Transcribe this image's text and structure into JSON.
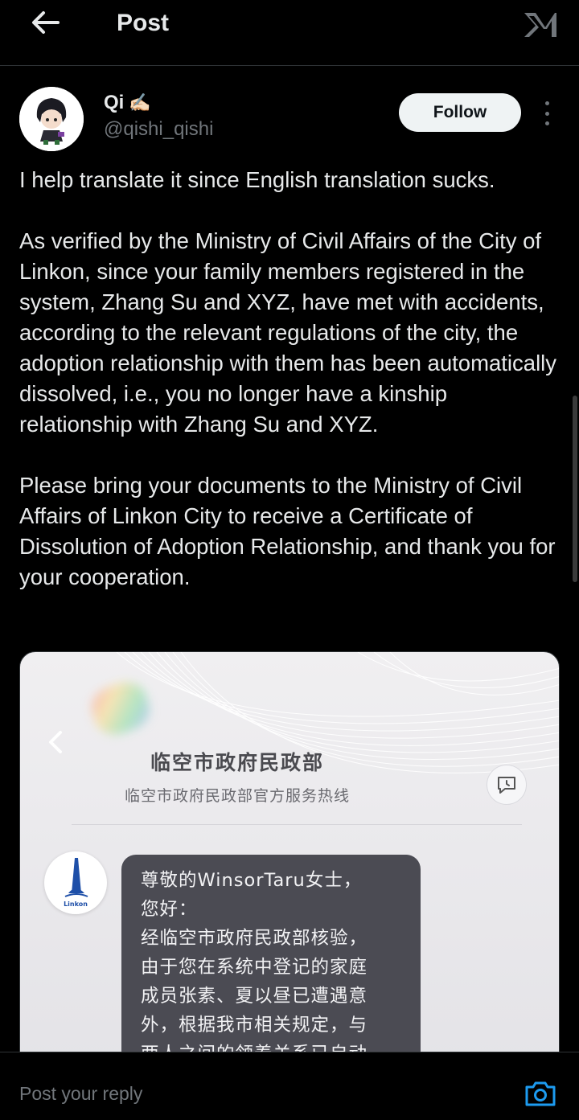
{
  "header": {
    "title": "Post",
    "back_icon": "arrow-left-icon",
    "logo_icon": "x-logo-icon"
  },
  "author": {
    "display_name": "Qi",
    "name_emoji": "✍🏻",
    "handle": "@qishi_qishi",
    "follow_label": "Follow",
    "more_icon": "more-vertical-icon"
  },
  "post": {
    "paragraphs": [
      "I help translate it since English translation sucks.",
      "As verified by the Ministry of Civil Affairs of the City of Linkon, since your family members registered in the system, Zhang Su and XYZ, have met with accidents, according to the relevant regulations of the city, the adoption relationship with them has been automatically dissolved, i.e., you no longer have a kinship relationship with Zhang Su and XYZ.",
      "Please bring your documents to the Ministry of Civil Affairs of Linkon City to receive a Certificate of Dissolution of Adoption Relationship, and thank you for your cooperation."
    ]
  },
  "screenshot": {
    "title": "临空市政府民政部",
    "subtitle": "临空市政府民政部官方服务热线",
    "avatar_text": "Linkon",
    "message_lines": [
      "尊敬的WinsorTaru女士，",
      "您好：",
      "经临空市政府民政部核验，",
      "由于您在系统中登记的家庭",
      "成员张素、夏以昼已遭遇意",
      "外，根据我市相关规定，与",
      "两人之间的领养关系已自动"
    ]
  },
  "reply": {
    "placeholder": "Post your reply",
    "camera_icon": "camera-icon"
  },
  "colors": {
    "background": "#000000",
    "text": "#e7e9ea",
    "muted": "#71767b",
    "accent": "#1d9bf0"
  }
}
